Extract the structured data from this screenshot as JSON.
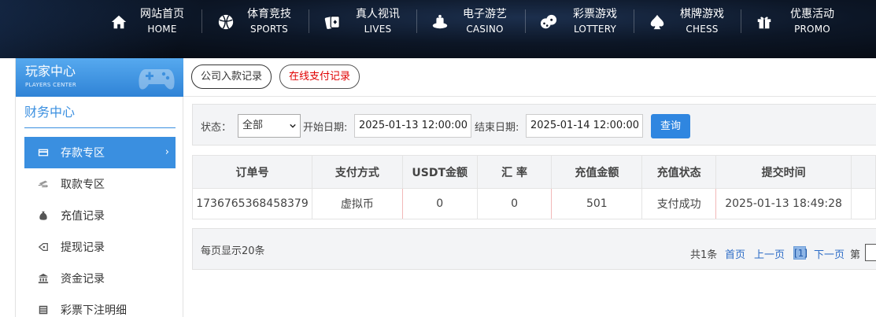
{
  "nav": {
    "items": [
      {
        "cn": "网站首页",
        "en": "HOME",
        "icon": "home-icon"
      },
      {
        "cn": "体育竞技",
        "en": "SPORTS",
        "icon": "basketball-icon"
      },
      {
        "cn": "真人视讯",
        "en": "LIVES",
        "icon": "cards-icon"
      },
      {
        "cn": "电子游艺",
        "en": "CASINO",
        "icon": "slot-icon"
      },
      {
        "cn": "彩票游戏",
        "en": "LOTTERY",
        "icon": "dice-icon"
      },
      {
        "cn": "棋牌游戏",
        "en": "CHESS",
        "icon": "spade-icon"
      },
      {
        "cn": "优惠活动",
        "en": "PROMO",
        "icon": "gift-icon"
      }
    ]
  },
  "sidebar": {
    "title": "玩家中心",
    "subtitle": "PLAYERS CENTER",
    "section": "财务中心",
    "items": [
      {
        "label": "存款专区",
        "icon": "card-icon",
        "active": true
      },
      {
        "label": "取款专区",
        "icon": "cash-icon",
        "active": false
      },
      {
        "label": "充值记录",
        "icon": "money-bag-icon",
        "active": false
      },
      {
        "label": "提现记录",
        "icon": "withdraw-icon",
        "active": false
      },
      {
        "label": "资金记录",
        "icon": "bank-icon",
        "active": false
      },
      {
        "label": "彩票下注明细",
        "icon": "list-icon",
        "active": false
      }
    ]
  },
  "tabs": {
    "company": "公司入款记录",
    "online": "在线支付记录"
  },
  "filter": {
    "status_label": "状态：",
    "status_value": "全部",
    "start_label": "开始日期:",
    "start_value": "2025-01-13 12:00:00",
    "end_label": "结束日期:",
    "end_value": "2025-01-14 12:00:00",
    "search_label": "查询"
  },
  "table": {
    "headers": [
      "订单号",
      "支付方式",
      "USDT金额",
      "汇 率",
      "充值金额",
      "充值状态",
      "提交时间"
    ],
    "rows": [
      [
        "1736765368458379",
        "虚拟币",
        "0",
        "0",
        "501",
        "支付成功",
        "2025-01-13 18:49:28"
      ]
    ]
  },
  "pager": {
    "per_page": "每页显示20条",
    "total": "共1条",
    "first": "首页",
    "prev": "上一页",
    "current": "[1]",
    "next": "下一页",
    "page_label": "第"
  },
  "colors": {
    "accent": "#3a8fe0",
    "button": "#2f86e0",
    "online_tab_text": "#e00000"
  }
}
